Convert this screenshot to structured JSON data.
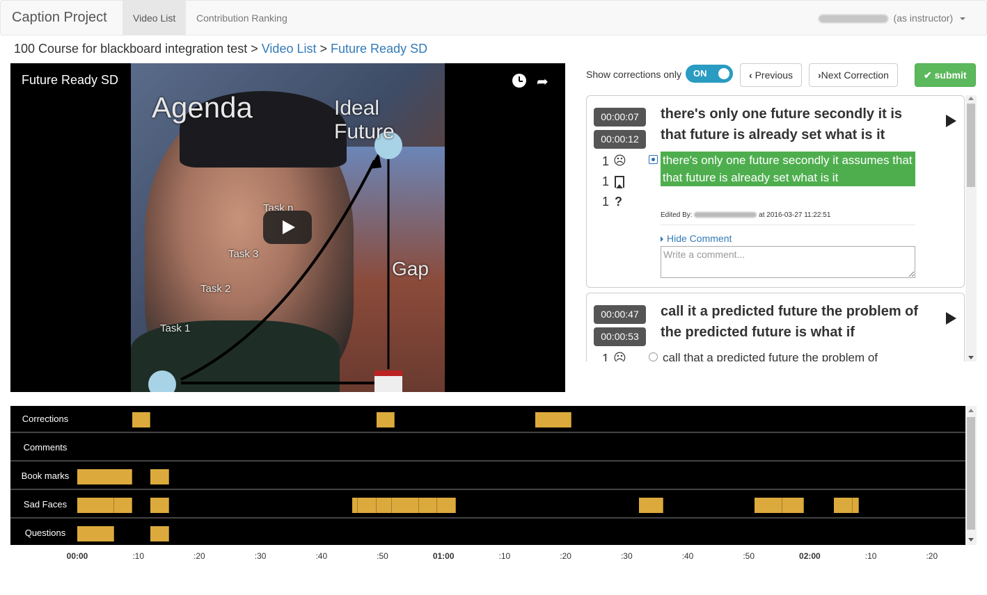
{
  "nav": {
    "brand": "Caption Project",
    "tabs": [
      {
        "label": "Video List",
        "active": true
      },
      {
        "label": "Contribution Ranking",
        "active": false
      }
    ],
    "user_suffix": "(as instructor)"
  },
  "breadcrumb": {
    "course": "100 Course for blackboard integration test",
    "sep": ">",
    "video_list": "Video List",
    "current": "Future Ready SD"
  },
  "video": {
    "title": "Future Ready SD",
    "slide_texts": {
      "agenda": "Agenda",
      "ideal_future": "Ideal Future",
      "task_n": "Task n",
      "task_3": "Task 3",
      "task_2": "Task 2",
      "task_1": "Task 1",
      "gap": "Gap"
    }
  },
  "controls": {
    "show_corrections_label": "Show corrections only",
    "toggle_state": "ON",
    "previous_label": "Previous",
    "next_label": "Next Correction",
    "submit_label": "submit"
  },
  "corrections": [
    {
      "start": "00:00:07",
      "end": "00:00:12",
      "caption": "there's only one future secondly it is that future is already set what is it",
      "sad_count": "1",
      "bookmark_count": "1",
      "question_count": "1",
      "correction": "there's only one future secondly it assumes that that future is already set what is it",
      "edited_prefix": "Edited By:",
      "edited_suffix": "at 2016-03-27 11:22:51",
      "hide_comment": "Hide Comment",
      "comment_placeholder": "Write a comment..."
    },
    {
      "start": "00:00:47",
      "end": "00:00:53",
      "caption": "call it a predicted future the problem of the predicted future is what if",
      "sad_count": "1",
      "correction": "call that a predicted future the problem of"
    }
  ],
  "timeline": {
    "rows": [
      {
        "label": "Corrections",
        "segments": [
          [
            9,
            12
          ],
          [
            49,
            52
          ],
          [
            75,
            81
          ]
        ]
      },
      {
        "label": "Comments",
        "segments": []
      },
      {
        "label": "Book marks",
        "segments": [
          [
            0,
            9
          ],
          [
            12,
            15
          ]
        ]
      },
      {
        "label": "Sad Faces",
        "segments": [
          [
            0,
            6
          ],
          [
            6,
            9
          ],
          [
            12,
            15
          ],
          [
            45,
            46
          ],
          [
            46,
            49
          ],
          [
            49,
            51.5
          ],
          [
            51.5,
            56
          ],
          [
            56,
            59
          ],
          [
            59,
            62
          ],
          [
            92,
            96
          ],
          [
            111,
            115.5
          ],
          [
            115.5,
            119
          ],
          [
            124,
            127
          ],
          [
            127,
            128
          ]
        ]
      },
      {
        "label": "Questions",
        "segments": [
          [
            0,
            6
          ],
          [
            12,
            15
          ]
        ]
      }
    ],
    "ticks": [
      {
        "label": "00:00",
        "major": true
      },
      {
        "label": ":10",
        "major": false
      },
      {
        "label": ":20",
        "major": false
      },
      {
        "label": ":30",
        "major": false
      },
      {
        "label": ":40",
        "major": false
      },
      {
        "label": ":50",
        "major": false
      },
      {
        "label": "01:00",
        "major": true
      },
      {
        "label": ":10",
        "major": false
      },
      {
        "label": ":20",
        "major": false
      },
      {
        "label": ":30",
        "major": false
      },
      {
        "label": ":40",
        "major": false
      },
      {
        "label": ":50",
        "major": false
      },
      {
        "label": "02:00",
        "major": true
      },
      {
        "label": ":10",
        "major": false
      },
      {
        "label": ":20",
        "major": false
      }
    ],
    "colors": {
      "segment": "#dcaa3c",
      "background": "#000000"
    }
  },
  "colors": {
    "link": "#337ab7",
    "success": "#5cb85c",
    "toggle": "#2a9bc1",
    "selected_correction": "#4eae4e"
  }
}
